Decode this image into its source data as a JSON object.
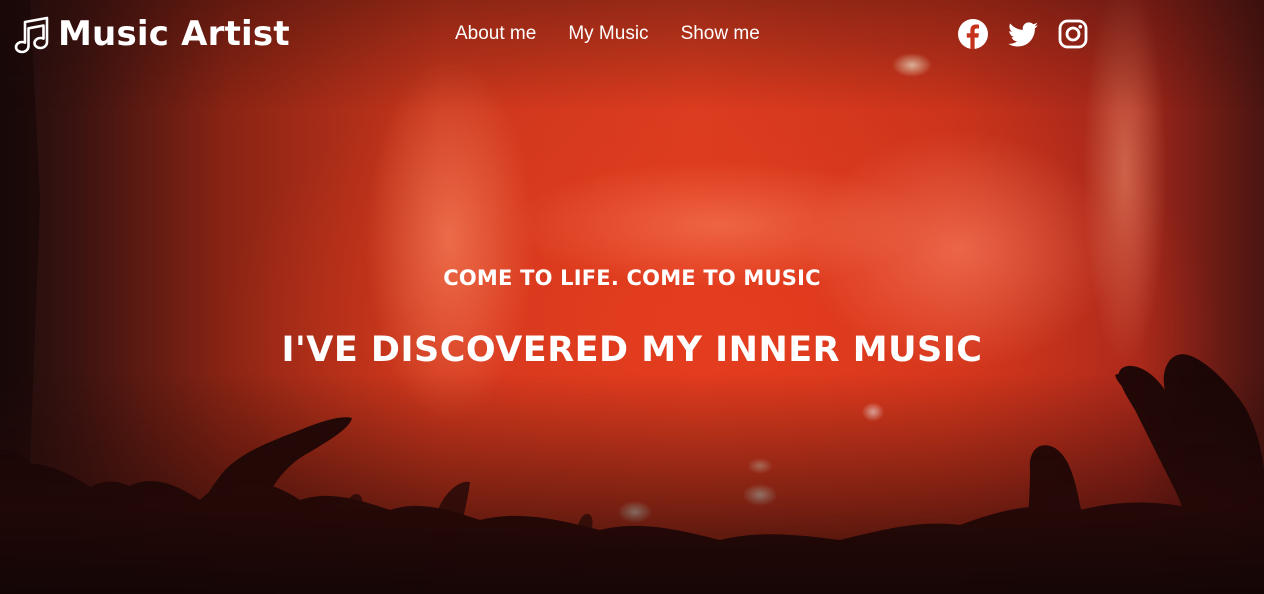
{
  "brand": {
    "icon": "music-note-icon",
    "name": "Music Artist"
  },
  "nav": {
    "items": [
      {
        "label": "About me"
      },
      {
        "label": "My Music"
      },
      {
        "label": "Show me"
      }
    ]
  },
  "social": [
    {
      "icon": "facebook-icon"
    },
    {
      "icon": "twitter-icon"
    },
    {
      "icon": "instagram-icon"
    }
  ],
  "hero": {
    "tagline": "COME TO LIFE. COME TO MUSIC",
    "headline": "I'VE DISCOVERED MY INNER MUSIC",
    "background": "concert-crowd-image"
  },
  "colors": {
    "text": "#ffffff",
    "background_accent": "#d93c1f"
  }
}
